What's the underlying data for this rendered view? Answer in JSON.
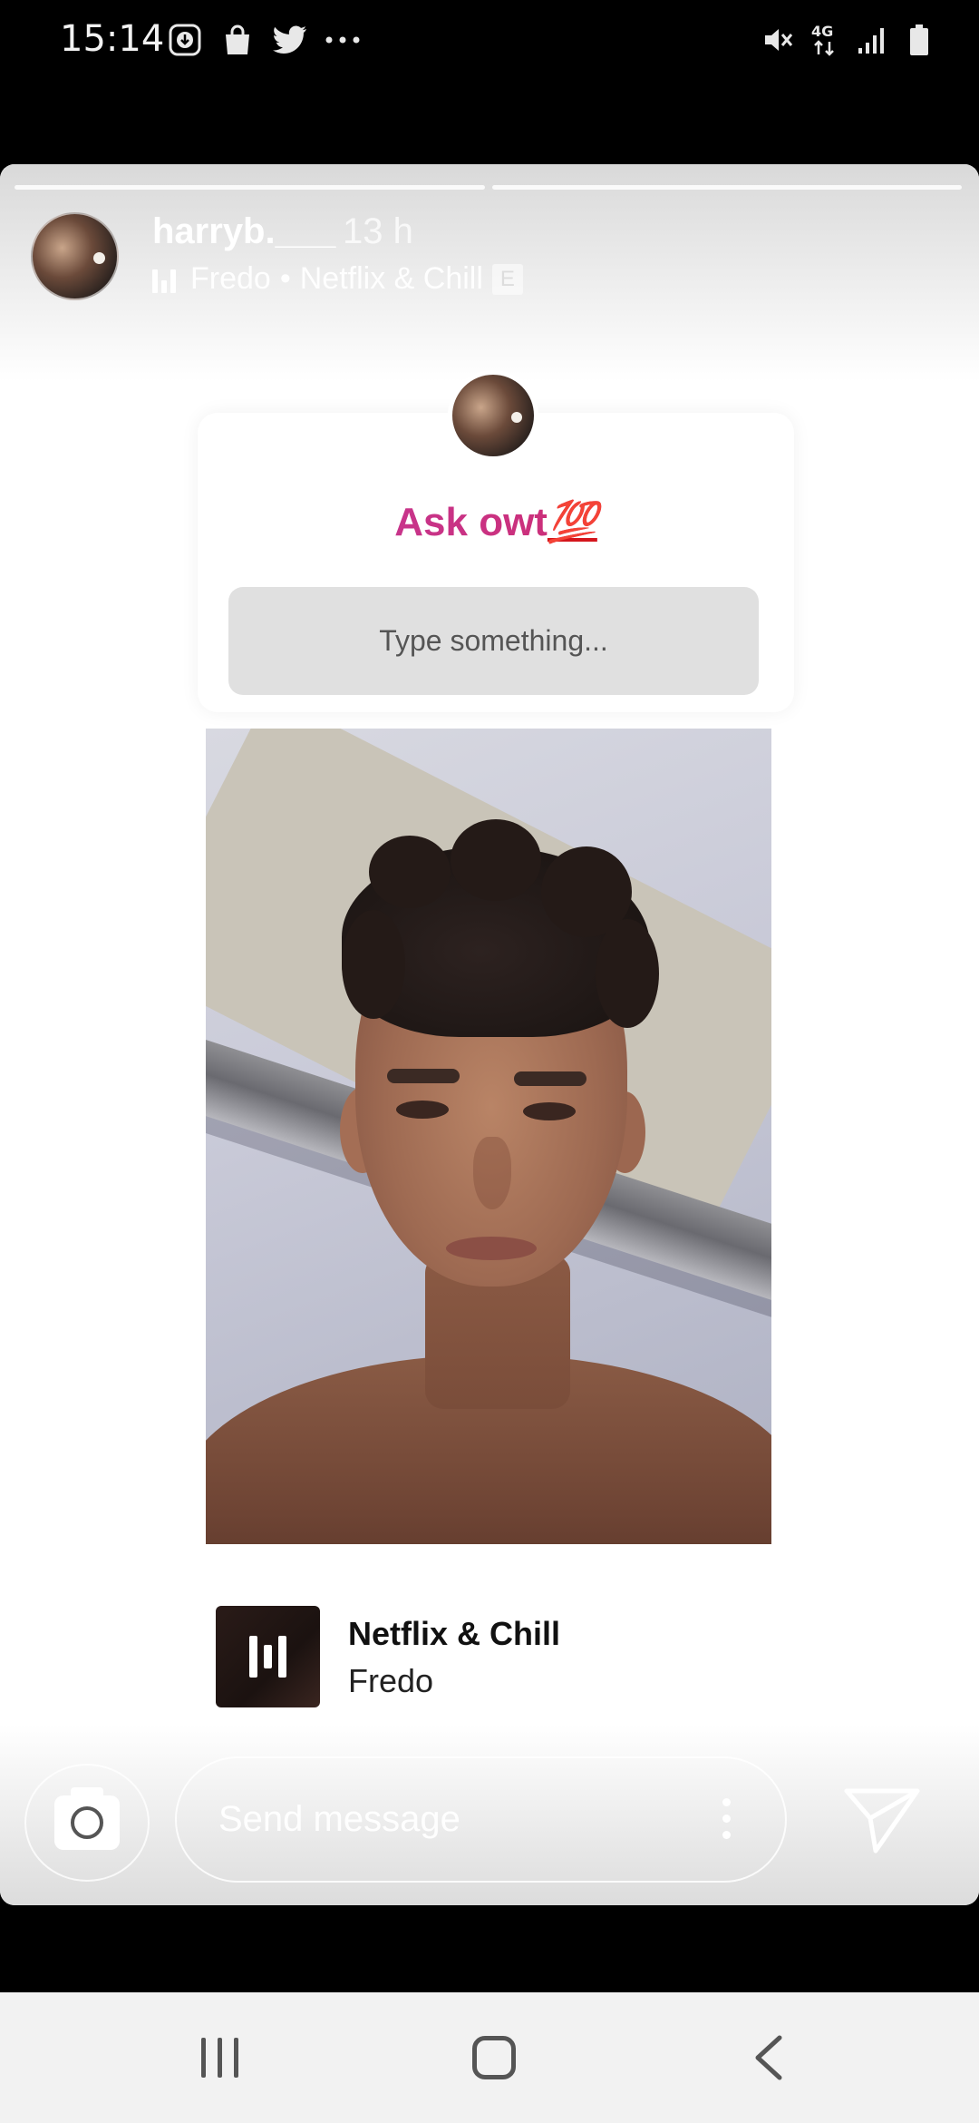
{
  "status_bar": {
    "time": "15:14",
    "left_icons": [
      "download-icon",
      "shopping-bag-icon",
      "twitter-icon",
      "more-dots-icon"
    ],
    "right_icons": [
      "mute-icon",
      "4g-icon",
      "signal-icon",
      "battery-icon"
    ],
    "network": "4G"
  },
  "story": {
    "username": "harryb.___",
    "time_ago": "13 h",
    "music_artist": "Fredo",
    "music_separator": "•",
    "music_title": "Netflix & Chill",
    "explicit_label": "E",
    "progress_segments": 2,
    "active_segment": 1
  },
  "question_sticker": {
    "title": "Ask owt",
    "emoji": "💯",
    "placeholder": "Type something..."
  },
  "music_sticker": {
    "title": "Netflix & Chill",
    "artist": "Fredo"
  },
  "bottom_bar": {
    "message_placeholder": "Send message"
  },
  "colors": {
    "question_gradient_start": "#c23aa0",
    "question_gradient_end": "#d22860",
    "nav_background": "#f2f2f2"
  }
}
